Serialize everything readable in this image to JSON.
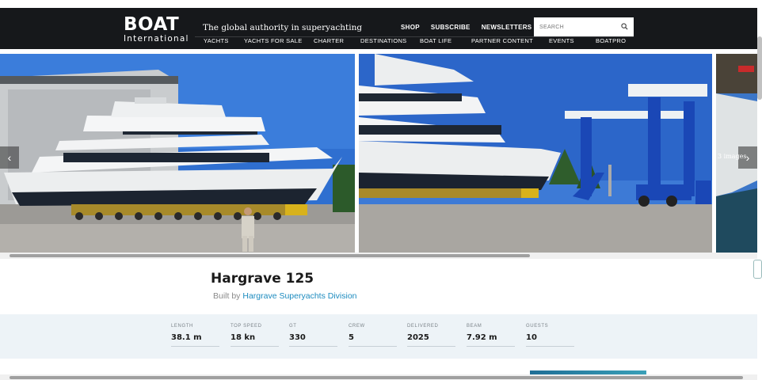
{
  "header": {
    "logo_main": "BOAT",
    "logo_sub": "International",
    "tagline": "The global authority in superyachting",
    "top_links": [
      "SHOP",
      "SUBSCRIBE",
      "NEWSLETTERS"
    ],
    "search_placeholder": "SEARCH",
    "nav": [
      "YACHTS",
      "YACHTS FOR SALE",
      "CHARTER",
      "DESTINATIONS",
      "BOAT LIFE",
      "PARTNER CONTENT",
      "EVENTS",
      "BOATPRO"
    ]
  },
  "gallery": {
    "image_count": "3 images",
    "prev_icon": "chevron-left-icon",
    "next_icon": "chevron-right-icon"
  },
  "yacht": {
    "name": "Hargrave 125",
    "built_by_prefix": "Built by",
    "builder": "Hargrave Superyachts Division"
  },
  "specs": [
    {
      "label": "LENGTH",
      "value": "38.1 m"
    },
    {
      "label": "TOP SPEED",
      "value": "18 kn"
    },
    {
      "label": "GT",
      "value": "330"
    },
    {
      "label": "CREW",
      "value": "5"
    },
    {
      "label": "DELIVERED",
      "value": "2025"
    },
    {
      "label": "BEAM",
      "value": "7.92 m"
    },
    {
      "label": "GUESTS",
      "value": "10"
    }
  ],
  "colors": {
    "header_bg": "#16181b",
    "accent_link": "#1c8bbf",
    "spec_band": "#edf3f7"
  }
}
